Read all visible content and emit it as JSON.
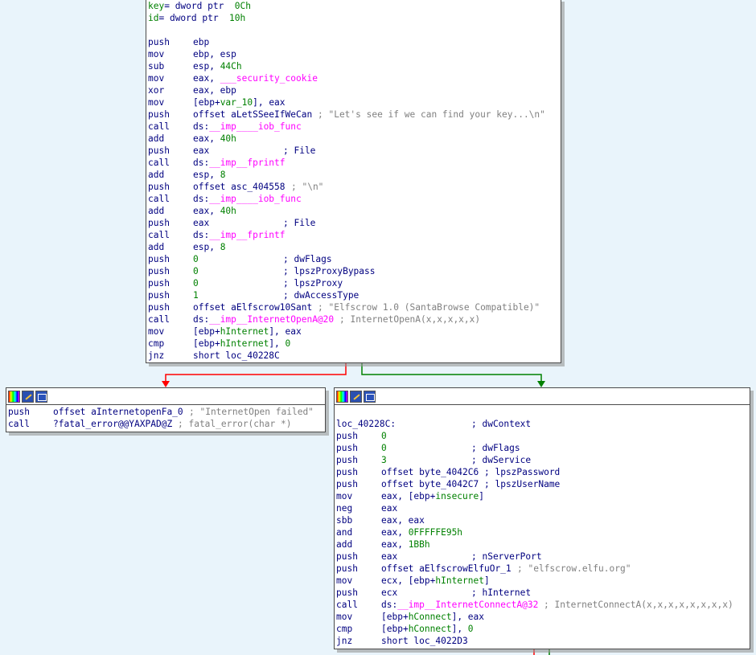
{
  "colors": {
    "background": "#e9f4fb",
    "mnemonic": "#000080",
    "number": "#008000",
    "import": "#ff00ff",
    "variable": "#008000",
    "comment": "#808080",
    "edge_false": "#ff0000",
    "edge_true": "#008000"
  },
  "header_icons": [
    "color-palette-icon",
    "edit-node-icon",
    "graph-overview-icon"
  ],
  "top_block": {
    "lines": [
      {
        "kind": "decl",
        "name": "key",
        "text": "= dword ptr  ",
        "num": "0Ch"
      },
      {
        "kind": "decl",
        "name": "id",
        "text": "= dword ptr  ",
        "num": "10h"
      },
      {
        "kind": "blank"
      },
      {
        "mn": "push",
        "parts": [
          {
            "c": "ky",
            "t": "ebp"
          }
        ]
      },
      {
        "mn": "mov",
        "parts": [
          {
            "c": "ky",
            "t": "ebp, esp"
          }
        ]
      },
      {
        "mn": "sub",
        "parts": [
          {
            "c": "ky",
            "t": "esp, "
          },
          {
            "c": "num",
            "t": "44Ch"
          }
        ]
      },
      {
        "mn": "mov",
        "parts": [
          {
            "c": "ky",
            "t": "eax, "
          },
          {
            "c": "imp",
            "t": "___security_cookie"
          }
        ]
      },
      {
        "mn": "xor",
        "parts": [
          {
            "c": "ky",
            "t": "eax, ebp"
          }
        ]
      },
      {
        "mn": "mov",
        "parts": [
          {
            "c": "ky",
            "t": "[ebp+"
          },
          {
            "c": "var",
            "t": "var_10"
          },
          {
            "c": "ky",
            "t": "], eax"
          }
        ]
      },
      {
        "mn": "push",
        "parts": [
          {
            "c": "ky",
            "t": "offset aLetSSeeIfWeCan"
          }
        ],
        "comment": "; \"Let's see if we can find your key...\\n\""
      },
      {
        "mn": "call",
        "parts": [
          {
            "c": "ky",
            "t": "ds:"
          },
          {
            "c": "imp",
            "t": "__imp____iob_func"
          }
        ]
      },
      {
        "mn": "add",
        "parts": [
          {
            "c": "ky",
            "t": "eax, "
          },
          {
            "c": "num",
            "t": "40h"
          }
        ]
      },
      {
        "mn": "push",
        "parts": [
          {
            "c": "ky",
            "t": "eax"
          }
        ],
        "comment": "; File",
        "col": "c2"
      },
      {
        "mn": "call",
        "parts": [
          {
            "c": "ky",
            "t": "ds:"
          },
          {
            "c": "imp",
            "t": "__imp__fprintf"
          }
        ]
      },
      {
        "mn": "add",
        "parts": [
          {
            "c": "ky",
            "t": "esp, "
          },
          {
            "c": "num",
            "t": "8"
          }
        ]
      },
      {
        "mn": "push",
        "parts": [
          {
            "c": "ky",
            "t": "offset asc_404558"
          }
        ],
        "comment": "; \"\\n\""
      },
      {
        "mn": "call",
        "parts": [
          {
            "c": "ky",
            "t": "ds:"
          },
          {
            "c": "imp",
            "t": "__imp____iob_func"
          }
        ]
      },
      {
        "mn": "add",
        "parts": [
          {
            "c": "ky",
            "t": "eax, "
          },
          {
            "c": "num",
            "t": "40h"
          }
        ]
      },
      {
        "mn": "push",
        "parts": [
          {
            "c": "ky",
            "t": "eax"
          }
        ],
        "comment": "; File",
        "col": "c2"
      },
      {
        "mn": "call",
        "parts": [
          {
            "c": "ky",
            "t": "ds:"
          },
          {
            "c": "imp",
            "t": "__imp__fprintf"
          }
        ]
      },
      {
        "mn": "add",
        "parts": [
          {
            "c": "ky",
            "t": "esp, "
          },
          {
            "c": "num",
            "t": "8"
          }
        ]
      },
      {
        "mn": "push",
        "parts": [
          {
            "c": "num",
            "t": "0"
          }
        ],
        "comment": "; dwFlags",
        "col": "c2"
      },
      {
        "mn": "push",
        "parts": [
          {
            "c": "num",
            "t": "0"
          }
        ],
        "comment": "; lpszProxyBypass",
        "col": "c2"
      },
      {
        "mn": "push",
        "parts": [
          {
            "c": "num",
            "t": "0"
          }
        ],
        "comment": "; lpszProxy",
        "col": "c2"
      },
      {
        "mn": "push",
        "parts": [
          {
            "c": "num",
            "t": "1"
          }
        ],
        "comment": "; dwAccessType",
        "col": "c2"
      },
      {
        "mn": "push",
        "parts": [
          {
            "c": "ky",
            "t": "offset aElfscrow10Sant"
          }
        ],
        "comment": "; \"Elfscrow 1.0 (SantaBrowse Compatible)\""
      },
      {
        "mn": "call",
        "parts": [
          {
            "c": "ky",
            "t": "ds:"
          },
          {
            "c": "imp",
            "t": "__imp__InternetOpenA@20"
          }
        ],
        "comment": "; InternetOpenA(x,x,x,x,x)"
      },
      {
        "mn": "mov",
        "parts": [
          {
            "c": "ky",
            "t": "[ebp+"
          },
          {
            "c": "var",
            "t": "hInternet"
          },
          {
            "c": "ky",
            "t": "], eax"
          }
        ]
      },
      {
        "mn": "cmp",
        "parts": [
          {
            "c": "ky",
            "t": "[ebp+"
          },
          {
            "c": "var",
            "t": "hInternet"
          },
          {
            "c": "ky",
            "t": "], "
          },
          {
            "c": "num",
            "t": "0"
          }
        ]
      },
      {
        "mn": "jnz",
        "parts": [
          {
            "c": "ky",
            "t": "short loc_40228C"
          }
        ]
      }
    ]
  },
  "left_block": {
    "lines": [
      {
        "mn": "push",
        "parts": [
          {
            "c": "ky",
            "t": "offset aInternetopenFa_0"
          }
        ],
        "comment": "; \"InternetOpen failed\""
      },
      {
        "mn": "call",
        "parts": [
          {
            "c": "ky",
            "t": "?fatal_error@@YAXPAD@Z"
          }
        ],
        "comment": "; fatal_error(char *)"
      }
    ]
  },
  "right_block": {
    "lines": [
      {
        "kind": "label",
        "name": "loc_40228C:",
        "comment": "; dwContext"
      },
      {
        "mn": "push",
        "parts": [
          {
            "c": "num",
            "t": "0"
          }
        ]
      },
      {
        "mn": "push",
        "parts": [
          {
            "c": "num",
            "t": "0"
          }
        ],
        "comment": "; dwFlags",
        "col": "c2"
      },
      {
        "mn": "push",
        "parts": [
          {
            "c": "num",
            "t": "3"
          }
        ],
        "comment": "; dwService",
        "col": "c2"
      },
      {
        "mn": "push",
        "parts": [
          {
            "c": "ky",
            "t": "offset byte_4042C6"
          }
        ],
        "comment": "; lpszPassword"
      },
      {
        "mn": "push",
        "parts": [
          {
            "c": "ky",
            "t": "offset byte_4042C7"
          }
        ],
        "comment": "; lpszUserName"
      },
      {
        "mn": "mov",
        "parts": [
          {
            "c": "ky",
            "t": "eax, [ebp+"
          },
          {
            "c": "var",
            "t": "insecure"
          },
          {
            "c": "ky",
            "t": "]"
          }
        ]
      },
      {
        "mn": "neg",
        "parts": [
          {
            "c": "ky",
            "t": "eax"
          }
        ]
      },
      {
        "mn": "sbb",
        "parts": [
          {
            "c": "ky",
            "t": "eax, eax"
          }
        ]
      },
      {
        "mn": "and",
        "parts": [
          {
            "c": "ky",
            "t": "eax, "
          },
          {
            "c": "num",
            "t": "0FFFFFE95h"
          }
        ]
      },
      {
        "mn": "add",
        "parts": [
          {
            "c": "ky",
            "t": "eax, "
          },
          {
            "c": "num",
            "t": "1BBh"
          }
        ]
      },
      {
        "mn": "push",
        "parts": [
          {
            "c": "ky",
            "t": "eax"
          }
        ],
        "comment": "; nServerPort",
        "col": "c2"
      },
      {
        "mn": "push",
        "parts": [
          {
            "c": "ky",
            "t": "offset aElfscrowElfuOr_1"
          }
        ],
        "comment": "; \"elfscrow.elfu.org\""
      },
      {
        "mn": "mov",
        "parts": [
          {
            "c": "ky",
            "t": "ecx, [ebp+"
          },
          {
            "c": "var",
            "t": "hInternet"
          },
          {
            "c": "ky",
            "t": "]"
          }
        ]
      },
      {
        "mn": "push",
        "parts": [
          {
            "c": "ky",
            "t": "ecx"
          }
        ],
        "comment": "; hInternet",
        "col": "c2"
      },
      {
        "mn": "call",
        "parts": [
          {
            "c": "ky",
            "t": "ds:"
          },
          {
            "c": "imp",
            "t": "__imp__InternetConnectA@32"
          }
        ],
        "comment": "; InternetConnectA(x,x,x,x,x,x,x,x)"
      },
      {
        "mn": "mov",
        "parts": [
          {
            "c": "ky",
            "t": "[ebp+"
          },
          {
            "c": "var",
            "t": "hConnect"
          },
          {
            "c": "ky",
            "t": "], eax"
          }
        ]
      },
      {
        "mn": "cmp",
        "parts": [
          {
            "c": "ky",
            "t": "[ebp+"
          },
          {
            "c": "var",
            "t": "hConnect"
          },
          {
            "c": "ky",
            "t": "], "
          },
          {
            "c": "num",
            "t": "0"
          }
        ]
      },
      {
        "mn": "jnz",
        "parts": [
          {
            "c": "ky",
            "t": "short loc_4022D3"
          }
        ]
      }
    ]
  }
}
